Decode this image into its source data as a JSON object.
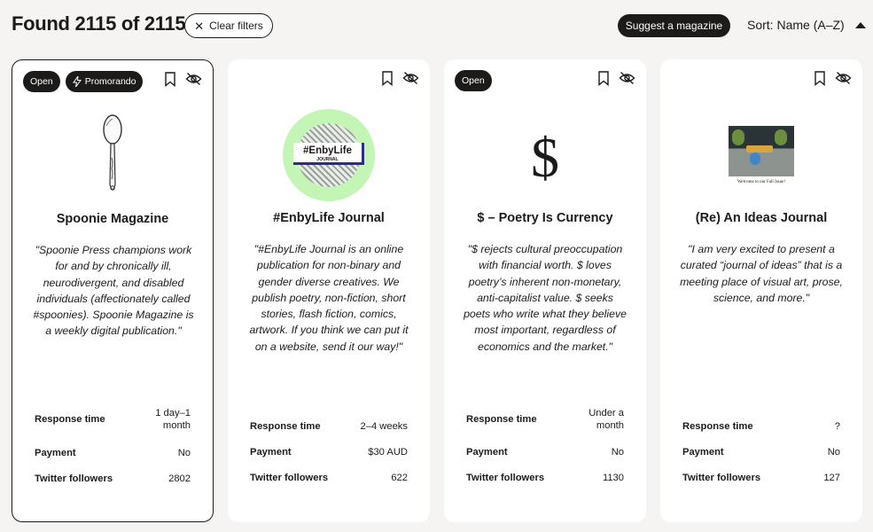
{
  "header": {
    "found": "Found 2115 of 2115",
    "clear_filters": "Clear filters",
    "suggest": "Suggest a magazine",
    "sort": "Sort: Name (A–Z)"
  },
  "labels": {
    "response_time": "Response time",
    "payment": "Payment",
    "twitter": "Twitter followers"
  },
  "cards": [
    {
      "badges": [
        "Open",
        "Promorando"
      ],
      "title": "Spoonie Magazine",
      "description": "\"Spoonie Press champions work for and by chronically ill, neurodivergent, and disabled individuals (affectionately called #spoonies). Spoonie Magazine is a weekly digital publication.\"",
      "response_time": "1 day–1 month",
      "payment": "No",
      "twitter_followers": "2802",
      "image_icon": "spoon-illustration"
    },
    {
      "badges": [],
      "title": "#EnbyLife Journal",
      "description": "\"#EnbyLife Journal is an online publication for non-binary and gender diverse creatives. We publish poetry, non-fiction, short stories, flash fiction, comics, artwork. If you think we can put it on a website, send it our way!\"",
      "response_time": "2–4 weeks",
      "payment": "$30 AUD",
      "twitter_followers": "622",
      "logo_main": "#EnbyLife",
      "logo_sub": "JOURNAL"
    },
    {
      "badges": [
        "Open"
      ],
      "title": "$ – Poetry Is Currency",
      "description": "\"$ rejects cultural preoccupation with financial worth. $ loves poetry’s inherent non-monetary, anti-capitalist value. $ seeks poets who write what they believe most important, regardless of economics and the market.\"",
      "response_time": "Under a month",
      "payment": "No",
      "twitter_followers": "1130",
      "logo_glyph": "$"
    },
    {
      "badges": [],
      "title": "(Re) An Ideas Journal",
      "description": "\"I am very excited to present a curated “journal of ideas” that is a meeting place of visual art, prose, science, and more.\"",
      "response_time": "?",
      "payment": "No",
      "twitter_followers": "127",
      "photo_caption": "Welcome to our Fall Issue!"
    }
  ],
  "colors": {
    "background": "#f5f4f2",
    "dark": "#1d1a1a",
    "enby_green": "#c3f5b4",
    "enby_blue": "#2c2b8f"
  }
}
